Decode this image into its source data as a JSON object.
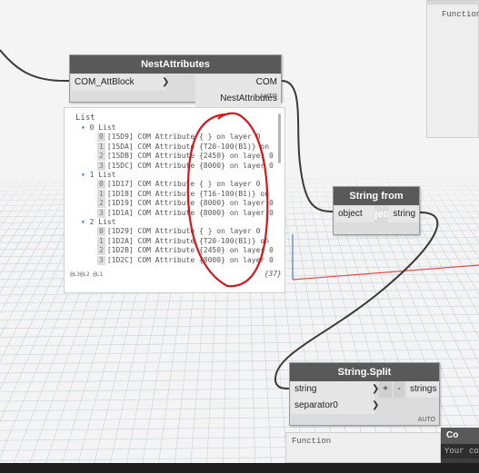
{
  "nodes": {
    "nest_attributes": {
      "title": "NestAttributes",
      "input_port": "COM_AttBlock",
      "output_port": "COM NestAttributes",
      "lacing": "AUTO"
    },
    "string_from_object": {
      "title": "String from Object",
      "input_port": "object",
      "output_port": "string"
    },
    "string_split": {
      "title": "String.Split",
      "input_ports": [
        "string",
        "separator0"
      ],
      "add_label": "+",
      "remove_label": "-",
      "output_port": "strings",
      "lacing": "AUTO"
    },
    "code_block": {
      "title": "Co",
      "placeholder": "Your co"
    }
  },
  "function_panels": {
    "top_right": "Function",
    "bottom": "Function"
  },
  "preview": {
    "root": "List",
    "groups": [
      {
        "label": "0 List",
        "items": [
          {
            "i": "0",
            "text": "[15D9] COM Attribute { } on layer 0"
          },
          {
            "i": "1",
            "text": "[15DA] COM Attribute {T20-100(B1)} on"
          },
          {
            "i": "2",
            "text": "[15DB] COM Attribute {2450} on layer 0"
          },
          {
            "i": "3",
            "text": "[15DC] COM Attribute {8000} on layer 0"
          }
        ]
      },
      {
        "label": "1 List",
        "items": [
          {
            "i": "0",
            "text": "[1D17] COM Attribute { } on layer 0"
          },
          {
            "i": "1",
            "text": "[1D18] COM Attribute {T16-100(B1)} on"
          },
          {
            "i": "2",
            "text": "[1D19] COM Attribute {8000} on layer 0"
          },
          {
            "i": "3",
            "text": "[1D1A] COM Attribute {8000} on layer 0"
          }
        ]
      },
      {
        "label": "2 List",
        "items": [
          {
            "i": "0",
            "text": "[1D29] COM Attribute { } on layer 0"
          },
          {
            "i": "1",
            "text": "[1D2A] COM Attribute {T20-100(B1)} on"
          },
          {
            "i": "2",
            "text": "[1D2B] COM Attribute {2450} on layer 0"
          },
          {
            "i": "3",
            "text": "[1D2C] COM Attribute {8000} on layer 0"
          }
        ]
      }
    ],
    "levels": "@L3@L2 @L1",
    "count": "{37}"
  },
  "colors": {
    "node_header": "#595959",
    "node_body": "#dcdcdc",
    "wire": "#3a3a3a",
    "annotation_circle": "#d9141b",
    "grid": "#d0d6dc",
    "axis_x": "#e05050",
    "axis_y": "#4a7fd8"
  }
}
